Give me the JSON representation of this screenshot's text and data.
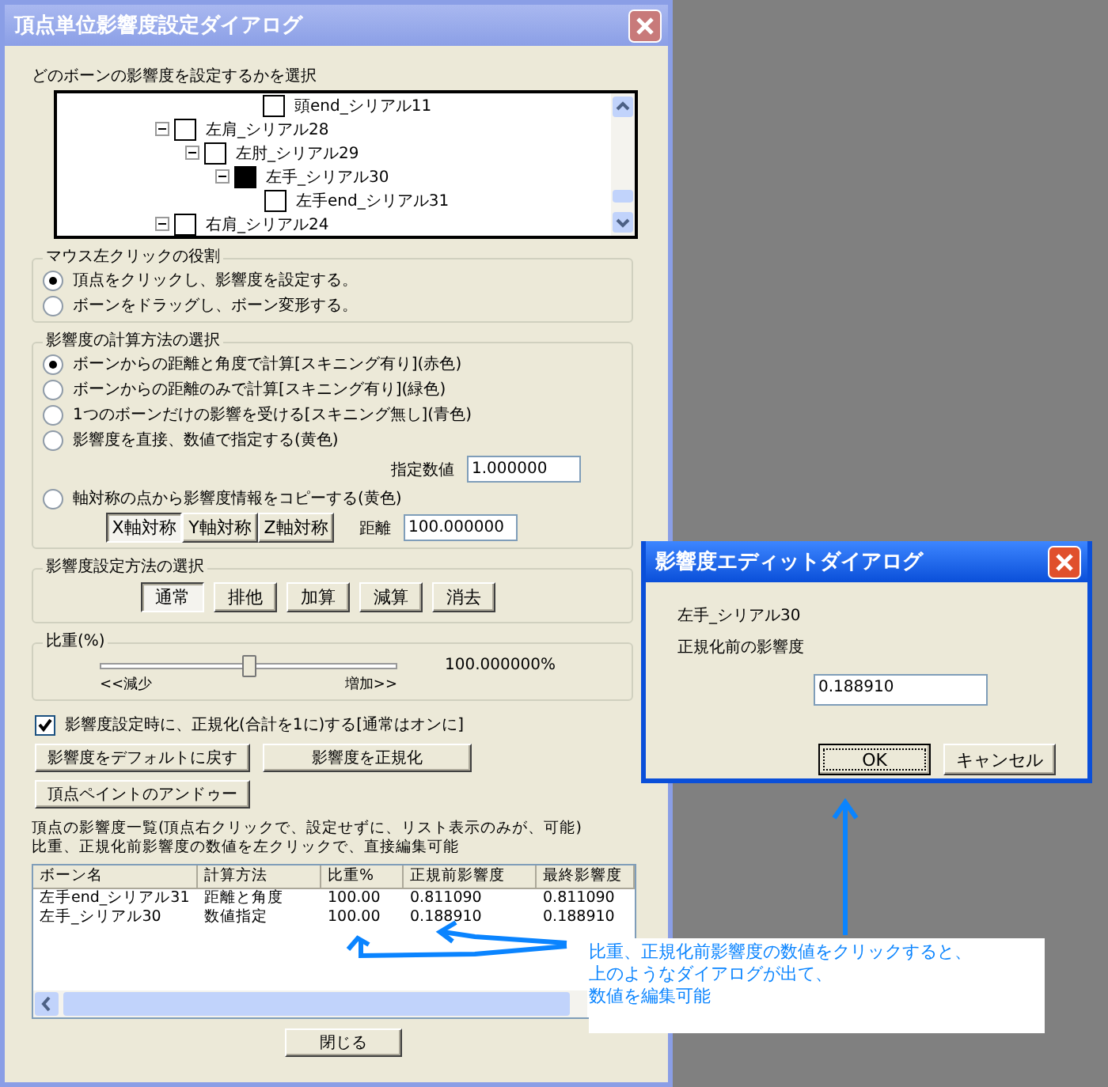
{
  "main_window": {
    "title": "頂点単位影響度設定ダイアログ",
    "bone_select": {
      "label": "どのボーンの影響度を設定するかを選択",
      "tree": [
        {
          "label": "頭end_シリアル11",
          "checked": false
        },
        {
          "label": "左肩_シリアル28",
          "checked": false,
          "expanded": true,
          "children": [
            {
              "label": "左肘_シリアル29",
              "checked": false,
              "expanded": true,
              "children": [
                {
                  "label": "左手_シリアル30",
                  "checked": true,
                  "expanded": true,
                  "children": [
                    {
                      "label": "左手end_シリアル31",
                      "checked": false
                    }
                  ]
                }
              ]
            }
          ]
        },
        {
          "label": "右肩_シリアル24",
          "checked": false,
          "expanded": true
        }
      ]
    },
    "mouse_role": {
      "title": "マウス左クリックの役割",
      "options": [
        {
          "label": "頂点をクリックし、影響度を設定する。",
          "selected": true
        },
        {
          "label": "ボーンをドラッグし、ボーン変形する。",
          "selected": false
        }
      ]
    },
    "calc_method": {
      "title": "影響度の計算方法の選択",
      "options": [
        {
          "label": "ボーンからの距離と角度で計算[スキニング有り](赤色)",
          "selected": true
        },
        {
          "label": "ボーンからの距離のみで計算[スキニング有り](緑色)",
          "selected": false
        },
        {
          "label": "1つのボーンだけの影響を受ける[スキニング無し](青色)",
          "selected": false
        },
        {
          "label": "影響度を直接、数値で指定する(黄色)",
          "selected": false
        },
        {
          "label": "軸対称の点から影響度情報をコピーする(黄色)",
          "selected": false
        }
      ],
      "value_label": "指定数値",
      "value": "1.000000",
      "symmetry_buttons": [
        {
          "label": "X軸対称",
          "selected": true
        },
        {
          "label": "Y軸対称",
          "selected": false
        },
        {
          "label": "Z軸対称",
          "selected": false
        }
      ],
      "distance_label": "距離",
      "distance": "100.000000"
    },
    "set_mode": {
      "title": "影響度設定方法の選択",
      "buttons": [
        {
          "label": "通常",
          "selected": true
        },
        {
          "label": "排他",
          "selected": false
        },
        {
          "label": "加算",
          "selected": false
        },
        {
          "label": "減算",
          "selected": false
        },
        {
          "label": "消去",
          "selected": false
        }
      ]
    },
    "weight": {
      "title": "比重(%)",
      "level": 0.5,
      "reading": "100.000000%",
      "min_label": "<<減少",
      "max_label": "増加>>"
    },
    "normalize": {
      "label": "影響度設定時に、正規化(合計を1に)する[通常はオンに]",
      "checked": true
    },
    "buttons": [
      "影響度をデフォルトに戻す",
      "影響度を正規化",
      "頂点ペイントのアンドゥー"
    ],
    "list": {
      "caption_lines": [
        "頂点の影響度一覧(頂点右クリックで、設定せずに、リスト表示のみが、可能)",
        "比重、正規化前影響度の数値を左クリックで、直接編集可能"
      ],
      "columns": [
        "ボーン名",
        "計算方法",
        "比重%",
        "正規前影響度",
        "最終影響度"
      ],
      "rows": [
        [
          "左手end_シリアル31",
          "距離と角度",
          "100.00",
          "0.811090",
          "0.811090"
        ],
        [
          "左手_シリアル30",
          "数値指定",
          "100.00",
          "0.188910",
          "0.188910"
        ]
      ]
    },
    "close_button": "閉じる"
  },
  "edit_dialog": {
    "title": "影響度エディットダイアログ",
    "bone": "左手_シリアル30",
    "label": "正規化前の影響度",
    "value": "0.188910",
    "buttons": [
      "OK",
      "キャンセル"
    ]
  },
  "annotation": {
    "lines": [
      "比重、正規化前影響度の数値をクリックすると、",
      "上のようなダイアログが出て、",
      "数値を編集可能"
    ]
  }
}
